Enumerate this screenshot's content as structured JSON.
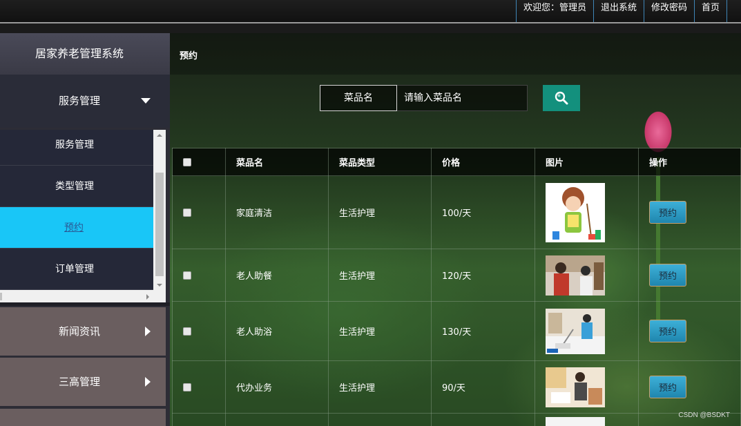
{
  "header": {
    "welcome": "欢迎您：管理员",
    "logout": "退出系统",
    "change_password": "修改密码",
    "home": "首页"
  },
  "sidebar": {
    "brand": "居家养老管理系统",
    "groups": [
      {
        "label": "服务管理",
        "expanded": true,
        "icon": "caret-down-icon"
      },
      {
        "label": "新闻资讯",
        "expanded": false,
        "icon": "caret-right-icon"
      },
      {
        "label": "三高管理",
        "expanded": false,
        "icon": "caret-right-icon"
      }
    ],
    "submenu": [
      {
        "label": "服务管理"
      },
      {
        "label": "类型管理"
      },
      {
        "label": "预约",
        "active": true
      },
      {
        "label": "订单管理"
      }
    ],
    "active_color": "#19c6f7"
  },
  "main": {
    "page_title": "预约",
    "search": {
      "label": "菜品名",
      "placeholder": "请输入菜品名",
      "button_icon": "search-icon"
    },
    "table": {
      "headers": [
        "菜品名",
        "菜品类型",
        "价格",
        "图片",
        "操作"
      ],
      "rows": [
        {
          "name": "家庭清洁",
          "type": "生活护理",
          "price": "100/天",
          "image": "cartoon-cleaner-image",
          "action": "预约"
        },
        {
          "name": "老人助餐",
          "type": "生活护理",
          "price": "120/天",
          "image": "meal-assist-photo",
          "action": "预约"
        },
        {
          "name": "老人助浴",
          "type": "生活护理",
          "price": "130/天",
          "image": "bath-assist-photo",
          "action": "预约"
        },
        {
          "name": "代办业务",
          "type": "生活护理",
          "price": "90/天",
          "image": "errand-service-photo",
          "action": "预约"
        }
      ]
    }
  },
  "watermark": "CSDN @BSDKT"
}
